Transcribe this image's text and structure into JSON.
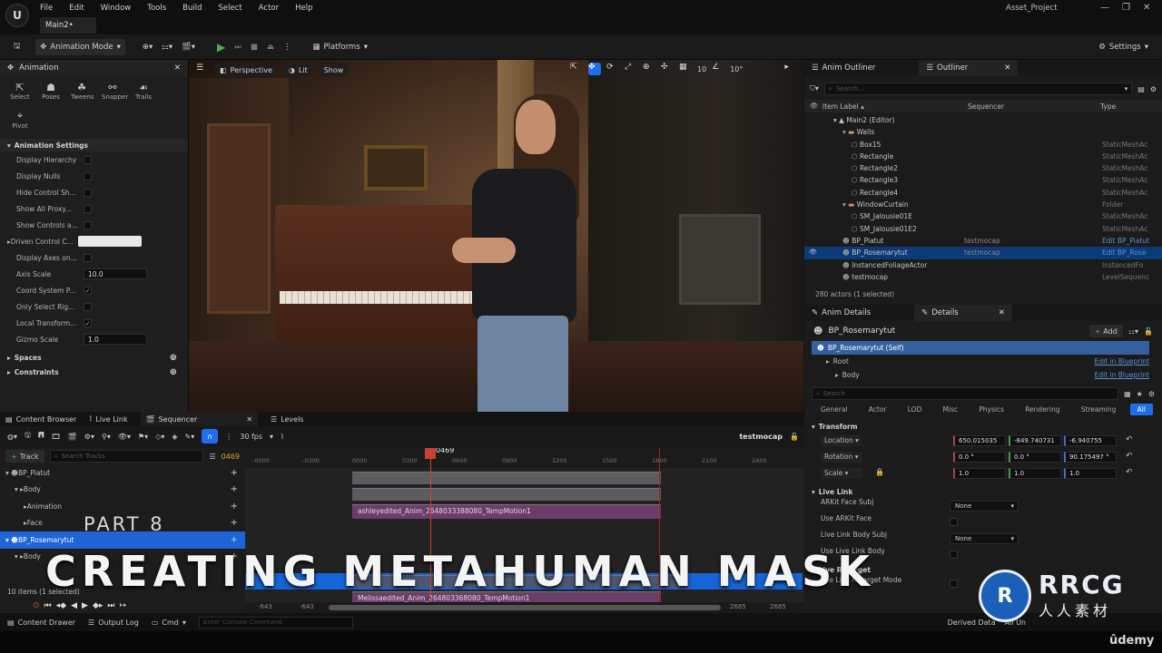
{
  "window": {
    "menu": [
      "File",
      "Edit",
      "Window",
      "Tools",
      "Build",
      "Select",
      "Actor",
      "Help"
    ],
    "doc_tab": "Main2•",
    "project_name": "Asset_Project",
    "controls": [
      "—",
      "❐",
      "✕"
    ]
  },
  "toolbar": {
    "mode_label": "Animation Mode",
    "platforms_label": "Platforms",
    "settings_label": "Settings"
  },
  "animation_panel": {
    "tab_label": "Animation",
    "tools": [
      {
        "label": "Select",
        "icon": "cursor-icon"
      },
      {
        "label": "Poses",
        "icon": "poses-icon"
      },
      {
        "label": "Tweens",
        "icon": "tweens-icon"
      },
      {
        "label": "Snapper",
        "icon": "snapper-icon"
      },
      {
        "label": "Trails",
        "icon": "trails-icon"
      },
      {
        "label": "Pivot",
        "icon": "pivot-icon"
      }
    ],
    "settings_header": "Animation Settings",
    "settings": [
      {
        "label": "Display Hierarchy",
        "type": "check",
        "checked": false
      },
      {
        "label": "Display Nulls",
        "type": "check",
        "checked": false
      },
      {
        "label": "Hide Control Sh...",
        "type": "check",
        "checked": false
      },
      {
        "label": "Show All Proxy...",
        "type": "check",
        "checked": false
      },
      {
        "label": "Show Controls a...",
        "type": "check",
        "checked": false
      },
      {
        "label": "Driven Control C...",
        "type": "color",
        "value": ""
      },
      {
        "label": "Display Axes on...",
        "type": "check",
        "checked": false
      },
      {
        "label": "Axis Scale",
        "type": "number",
        "value": "10.0"
      },
      {
        "label": "Coord System P...",
        "type": "check",
        "checked": true
      },
      {
        "label": "Only Select Rig...",
        "type": "check",
        "checked": false
      },
      {
        "label": "Local Transform...",
        "type": "check",
        "checked": true
      },
      {
        "label": "Gizmo Scale",
        "type": "number",
        "value": "1.0"
      }
    ],
    "sections": [
      "Spaces",
      "Constraints"
    ]
  },
  "viewport": {
    "perspective_label": "Perspective",
    "lit_label": "Lit",
    "show_label": "Show",
    "grid_snap": "10",
    "rot_snap": "10°"
  },
  "outliner": {
    "tabs": [
      "Anim Outliner",
      "Outliner"
    ],
    "search_placeholder": "Search...",
    "columns": [
      "Item Label ▴",
      "Sequencer",
      "Type"
    ],
    "rows": [
      {
        "name": "Main2 (Editor)",
        "indent": 1,
        "icon": "level",
        "seq": "",
        "type": ""
      },
      {
        "name": "Walls",
        "indent": 2,
        "icon": "folder",
        "seq": "",
        "type": ""
      },
      {
        "name": "Box15",
        "indent": 3,
        "icon": "mesh",
        "seq": "",
        "type": "StaticMeshAc"
      },
      {
        "name": "Rectangle",
        "indent": 3,
        "icon": "mesh",
        "seq": "",
        "type": "StaticMeshAc"
      },
      {
        "name": "Rectangle2",
        "indent": 3,
        "icon": "mesh",
        "seq": "",
        "type": "StaticMeshAc"
      },
      {
        "name": "Rectangle3",
        "indent": 3,
        "icon": "mesh",
        "seq": "",
        "type": "StaticMeshAc"
      },
      {
        "name": "Rectangle4",
        "indent": 3,
        "icon": "mesh",
        "seq": "",
        "type": "StaticMeshAc"
      },
      {
        "name": "WindowCurtain",
        "indent": 2,
        "icon": "folder",
        "seq": "",
        "type": "Folder"
      },
      {
        "name": "SM_Jalousie01E",
        "indent": 3,
        "icon": "mesh",
        "seq": "",
        "type": "StaticMeshAc"
      },
      {
        "name": "SM_Jalousie01E2",
        "indent": 3,
        "icon": "mesh",
        "seq": "",
        "type": "StaticMeshAc"
      },
      {
        "name": "BP_Piatut",
        "indent": 2,
        "icon": "actor",
        "seq": "testmocap",
        "type": "Edit BP_Piatut"
      },
      {
        "name": "BP_Rosemarytut",
        "indent": 2,
        "icon": "actor",
        "seq": "testmocap",
        "type": "Edit BP_Rose",
        "selected": true
      },
      {
        "name": "InstancedFoliageActor",
        "indent": 2,
        "icon": "actor",
        "seq": "",
        "type": "InstancedFo"
      },
      {
        "name": "testmocap",
        "indent": 2,
        "icon": "actor",
        "seq": "",
        "type": "LevelSequenc"
      }
    ],
    "footer": "280 actors (1 selected)"
  },
  "details": {
    "tabs": [
      "Anim Details",
      "Details"
    ],
    "actor_name": "BP_Rosemarytut",
    "add_label": "Add",
    "components": [
      {
        "name": "BP_Rosemarytut (Self)",
        "link": ""
      },
      {
        "name": "Root",
        "link": "Edit in Blueprint"
      },
      {
        "name": "Body",
        "link": "Edit in Blueprint"
      }
    ],
    "search_placeholder": "Search",
    "categories": [
      "General",
      "Actor",
      "LOD",
      "Misc",
      "Physics",
      "Rendering",
      "Streaming",
      "All"
    ],
    "transform_header": "Transform",
    "transform": [
      {
        "label": "Location",
        "values": [
          "650.015035",
          "-849.740731",
          "-6.940755"
        ]
      },
      {
        "label": "Rotation",
        "values": [
          "0.0 °",
          "0.0 °",
          "90.175497 °"
        ]
      },
      {
        "label": "Scale",
        "values": [
          "1.0",
          "1.0",
          "1.0"
        ]
      }
    ],
    "livelink_header": "Live Link",
    "livelink": [
      {
        "label": "ARKit Face Subj",
        "value": "None"
      },
      {
        "label": "Use ARKit Face",
        "value": ""
      },
      {
        "label": "Live Link Body Subj",
        "value": "None"
      },
      {
        "label": "Use Live Link Body",
        "value": ""
      }
    ],
    "retarget_header": "Live Retarget",
    "retarget_row": "Use Live Retarget Mode"
  },
  "bottom_tabs": [
    "Content Browser",
    "Live Link",
    "Sequencer",
    "Levels"
  ],
  "sequencer": {
    "fps": "30 fps",
    "sequence_name": "testmocap",
    "track_button": "Track",
    "search_placeholder": "Search Tracks",
    "current_frame": "0469",
    "playhead_label": "0469",
    "ruler_ticks": [
      "-0000",
      "-0300",
      "0000",
      "0300",
      "0600",
      "0900",
      "1200",
      "1500",
      "1800",
      "2100",
      "2400"
    ],
    "tracks": [
      {
        "label": "BP_Piatut",
        "indent": 0
      },
      {
        "label": "Body",
        "indent": 1
      },
      {
        "label": "Animation",
        "indent": 2
      },
      {
        "label": "Face",
        "indent": 2
      },
      {
        "label": "BP_Rosemarytut",
        "indent": 0,
        "selected": true
      },
      {
        "label": "Body",
        "indent": 1
      }
    ],
    "clip1": "ashleyedited_Anim_2648033388080_TempMotion1",
    "clip2": "Melissaedited_Anim_264803368080_TempMotion1",
    "items_status": "10 items (1 selected)",
    "range_start": "-643",
    "range_start2": "-643",
    "range_end": "2685",
    "range_end2": "2685"
  },
  "overlay": {
    "part": "PART 8",
    "title": "CREATING METAHUMAN MASK"
  },
  "statusbar": {
    "items": [
      "Content Drawer",
      "Output Log",
      "Cmd"
    ],
    "cmd_placeholder": "Enter Console Command",
    "right_items": [
      "Derived Data",
      "All Un"
    ]
  },
  "watermark": {
    "badge": "R",
    "line1": "RRCG",
    "line2": "人人素材"
  },
  "brand": "ûdemy"
}
